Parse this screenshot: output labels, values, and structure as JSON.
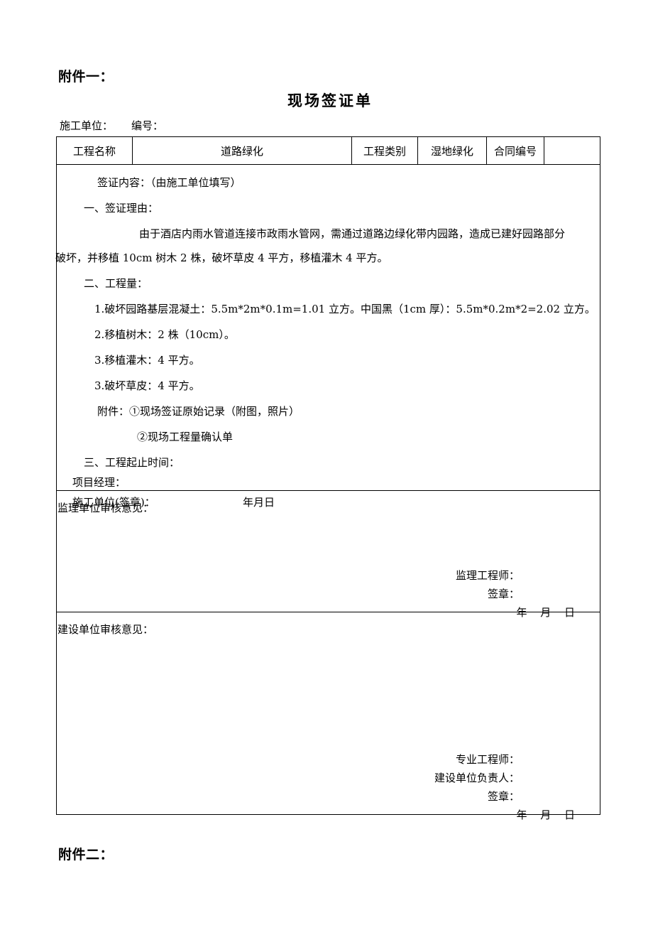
{
  "attachments": {
    "first_label": "附件一：",
    "second_label": "附件二："
  },
  "document": {
    "title": "现场签证单",
    "construction_unit_label": "施工单位：",
    "serial_label": "编号："
  },
  "header_table": {
    "project_name_label": "工程名称",
    "project_name_value": "道路绿化",
    "project_type_label": "工程类别",
    "project_type_value": "湿地绿化",
    "contract_no_label": "合同编号",
    "contract_no_value": ""
  },
  "content": {
    "intro": "签证内容：（由施工单位填写）",
    "section_one_title": "一、签证理由：",
    "reason_line1": "由于酒店内雨水管道连接市政雨水管网，需通过道路边绿化带内园路，造成已建好园路部分",
    "reason_line2": "破坏，并移植 10cm 树木 2 株，破坏草皮 4 平方，移植灌木 4 平方。",
    "section_two_title": "二、工程量：",
    "qty_item1": "1.破坏园路基层混凝土：5.5m*2m*0.1m=1.01 立方。中国黑（1cm 厚）：5.5m*0.2m*2=2.02 立方。",
    "qty_item2": "2.移植树木：2 株（10cm）。",
    "qty_item3": "3.移植灌木：4 平方。",
    "qty_item4": "3.破坏草皮：4 平方。",
    "attach_line1": "附件：①现场签证原始记录（附图，照片）",
    "attach_line2": "②现场工程量确认单",
    "section_three_title": "三、工程起止时间：",
    "project_manager": "项目经理：",
    "construction_unit_seal": "施工单位(签章)：",
    "construction_date": "年月日"
  },
  "supervision": {
    "title": "监理单位审核意见：",
    "engineer_label": "监理工程师：",
    "seal_label": "签章：",
    "date_label": "年 月  日"
  },
  "owner": {
    "title": "建设单位审核意见：",
    "professional_engineer_label": "专业工程师：",
    "unit_head_label": "建设单位负责人：",
    "seal_label": "签章：",
    "date_label": "年 月  日"
  }
}
